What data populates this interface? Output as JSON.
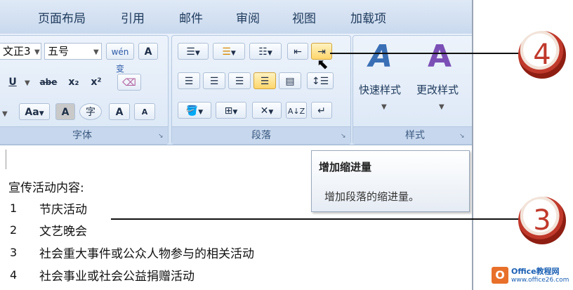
{
  "tabs": [
    "页面布局",
    "引用",
    "邮件",
    "审阅",
    "视图",
    "加载项"
  ],
  "font_group": {
    "font_name": "文正3",
    "font_size": "五号",
    "label": "字体",
    "wen_btn": "wén 变",
    "a_box": "A",
    "underline": "U",
    "strike": "abe",
    "subscript": "x₂",
    "superscript": "x²",
    "case": "Aa",
    "shade_a": "A",
    "circle_char": "字",
    "grow": "A",
    "shrink": "A"
  },
  "paragraph_group": {
    "label": "段落"
  },
  "styles_group": {
    "quick_styles": "快速样式",
    "change_styles": "更改样式",
    "label": "样式"
  },
  "tooltip": {
    "title": "增加缩进量",
    "description": "增加段落的缩进量。"
  },
  "document": {
    "heading": "宣传活动内容:",
    "items": [
      {
        "num": "1",
        "text": "节庆活动"
      },
      {
        "num": "2",
        "text": "文艺晚会"
      },
      {
        "num": "3",
        "text": "社会重大事件或公众人物参与的相关活动"
      },
      {
        "num": "4",
        "text": "社会事业或社会公益捐赠活动"
      }
    ]
  },
  "callouts": [
    "4",
    "3"
  ],
  "watermark": {
    "brand": "Office教程网",
    "url": "www.office26.com"
  },
  "colors": {
    "callout_red": "#c0392b",
    "ribbon_blue": "#dbe7f6",
    "highlight": "#ffd66b"
  }
}
